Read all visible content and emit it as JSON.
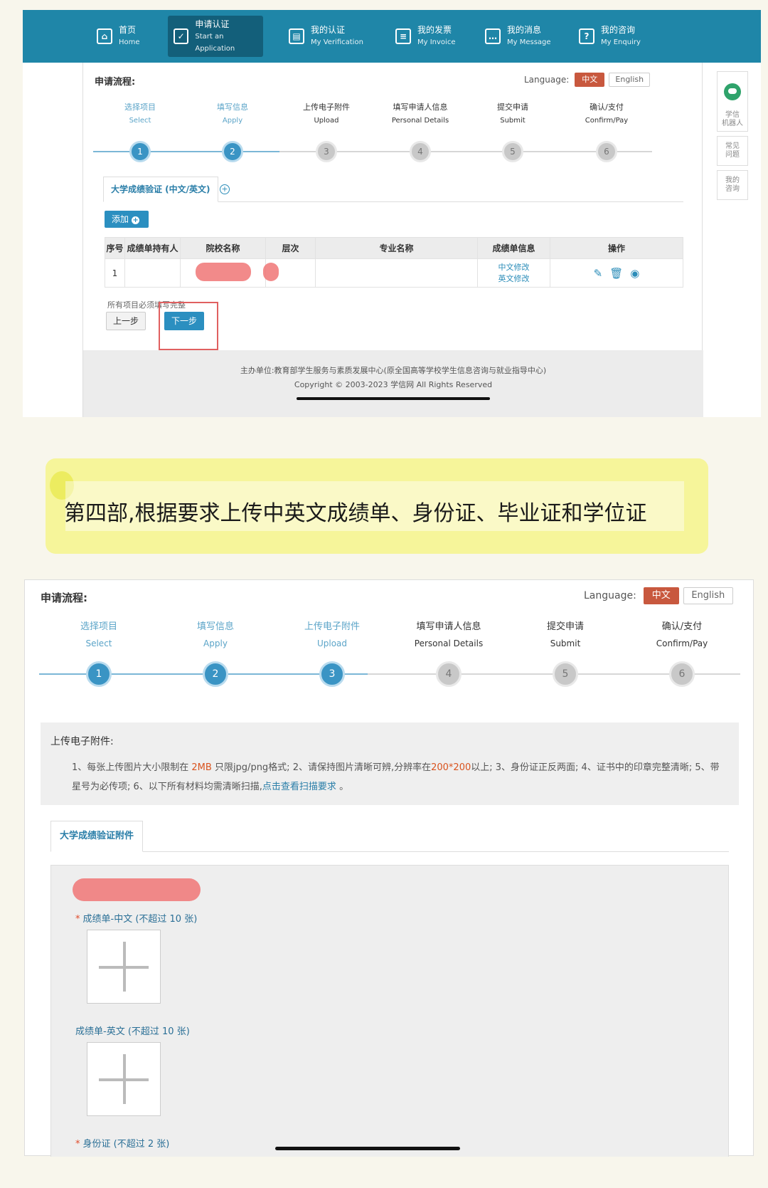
{
  "nav": [
    {
      "zh": "首页",
      "en": "Home",
      "icon": "home-icon"
    },
    {
      "zh": "申请认证",
      "en": "Start an Application",
      "icon": "check-icon"
    },
    {
      "zh": "我的认证",
      "en": "My Verification",
      "icon": "verification-icon"
    },
    {
      "zh": "我的发票",
      "en": "My Invoice",
      "icon": "invoice-icon"
    },
    {
      "zh": "我的消息",
      "en": "My Message",
      "icon": "message-icon"
    },
    {
      "zh": "我的咨询",
      "en": "My Enquiry",
      "icon": "question-icon"
    }
  ],
  "process_title": "申请流程:",
  "language": {
    "label": "Language:",
    "zh": "中文",
    "en": "English"
  },
  "steps": [
    {
      "zh": "选择项目",
      "en": "Select",
      "num": "1"
    },
    {
      "zh": "填写信息",
      "en": "Apply",
      "num": "2"
    },
    {
      "zh": "上传电子附件",
      "en": "Upload",
      "num": "3"
    },
    {
      "zh": "填写申请人信息",
      "en": "Personal Details",
      "num": "4"
    },
    {
      "zh": "提交申请",
      "en": "Submit",
      "num": "5"
    },
    {
      "zh": "确认/支付",
      "en": "Confirm/Pay",
      "num": "6"
    }
  ],
  "shot1": {
    "completed_steps": 2,
    "tab": "大学成绩验证 (中文/英文)",
    "add_button": "添加",
    "table": {
      "headers": [
        "序号",
        "成绩单持有人",
        "院校名称",
        "层次",
        "专业名称",
        "成绩单信息",
        "操作"
      ],
      "rows": [
        {
          "index": "1",
          "transcript_zh": "中文修改",
          "transcript_en": "英文修改"
        }
      ]
    },
    "must_complete": "所有项目必须填写完整",
    "prev_button": "上一步",
    "next_button": "下一步",
    "footer_line1": "主办单位:教育部学生服务与素质发展中心(原全国高等学校学生信息咨询与就业指导中心)",
    "footer_line2": "Copyright © 2003-2023 学信网 All Rights Reserved"
  },
  "sidebar": [
    {
      "label": "学信\n机器人",
      "icon": "robot-icon"
    },
    {
      "label": "常见\n问题"
    },
    {
      "label": "我的\n咨询"
    }
  ],
  "caption": "第四部,根据要求上传中英文成绩单、身份证、毕业证和学位证",
  "shot2": {
    "completed_steps": 3,
    "upload_title": "上传电子附件:",
    "instructions": {
      "p1": "1、每张上传图片大小限制在 ",
      "size": "2MB",
      "p2": " 只限jpg/png格式; 2、请保持图片清晰可辨,分辨率在",
      "res": "200*200",
      "p3": "以上; 3、身份证正反两面; 4、证书中的印章完整清晰; 5、带星号为必传项; 6、以下所有材料均需清晰扫描,",
      "link": "点击查看扫描要求",
      "p4": " 。"
    },
    "tab": "大学成绩验证附件",
    "uploads": [
      {
        "label": "成绩单-中文 (不超过 10 张)",
        "required": true
      },
      {
        "label": "成绩单-英文 (不超过 10 张)",
        "required": false
      },
      {
        "label": "身份证 (不超过 2 张)",
        "required": true
      }
    ]
  },
  "colors": {
    "nav_bg": "#1f86a8",
    "accent_blue": "#2b8fc0",
    "lang_active": "#c8583e",
    "highlight_box": "#e06060",
    "caption_bg": "#f6f59a"
  }
}
